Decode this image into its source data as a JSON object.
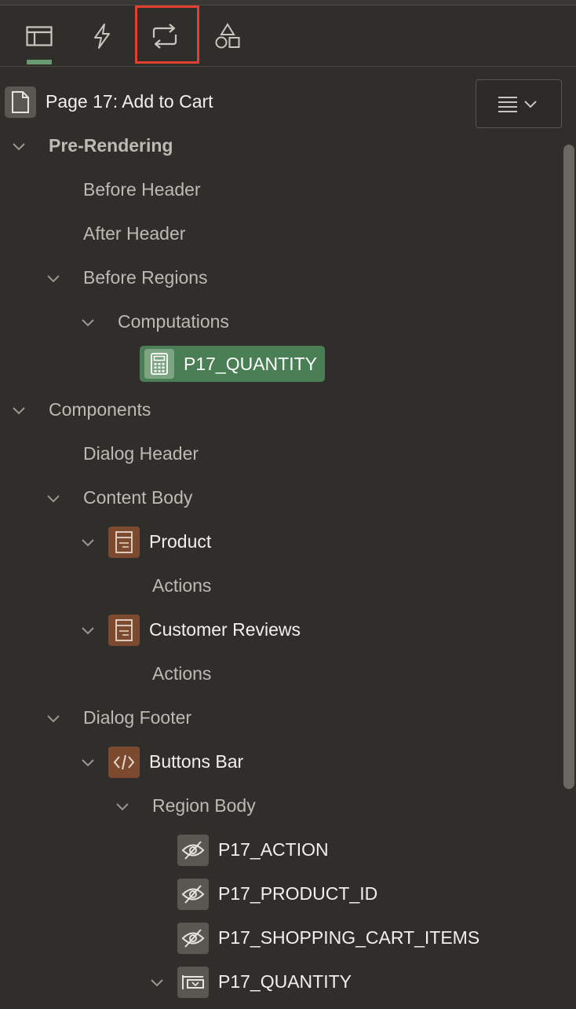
{
  "toolbar": {
    "tabs": [
      {
        "icon": "layout-icon",
        "active": true
      },
      {
        "icon": "lightning-icon",
        "active": false
      },
      {
        "icon": "processing-loop-icon",
        "active": false,
        "highlighted": true
      },
      {
        "icon": "shapes-icon",
        "active": false
      }
    ]
  },
  "page": {
    "title": "Page 17: Add to Cart",
    "menu_icon": "menu-lines-chevron-icon"
  },
  "tree": {
    "pre_rendering": "Pre-Rendering",
    "before_header": "Before Header",
    "after_header": "After Header",
    "before_regions": "Before Regions",
    "computations": "Computations",
    "computation_item": "P17_QUANTITY",
    "components": "Components",
    "dialog_header": "Dialog Header",
    "content_body": "Content Body",
    "product": "Product",
    "product_actions": "Actions",
    "customer_reviews": "Customer Reviews",
    "reviews_actions": "Actions",
    "dialog_footer": "Dialog Footer",
    "buttons_bar": "Buttons Bar",
    "region_body": "Region Body",
    "item_action": "P17_ACTION",
    "item_product_id": "P17_PRODUCT_ID",
    "item_cart_items": "P17_SHOPPING_CART_ITEMS",
    "item_quantity": "P17_QUANTITY"
  },
  "colors": {
    "background": "#302e2b",
    "selected": "#4a7e55",
    "region_badge": "#7b4a2f",
    "highlight_border": "#e0402f"
  }
}
